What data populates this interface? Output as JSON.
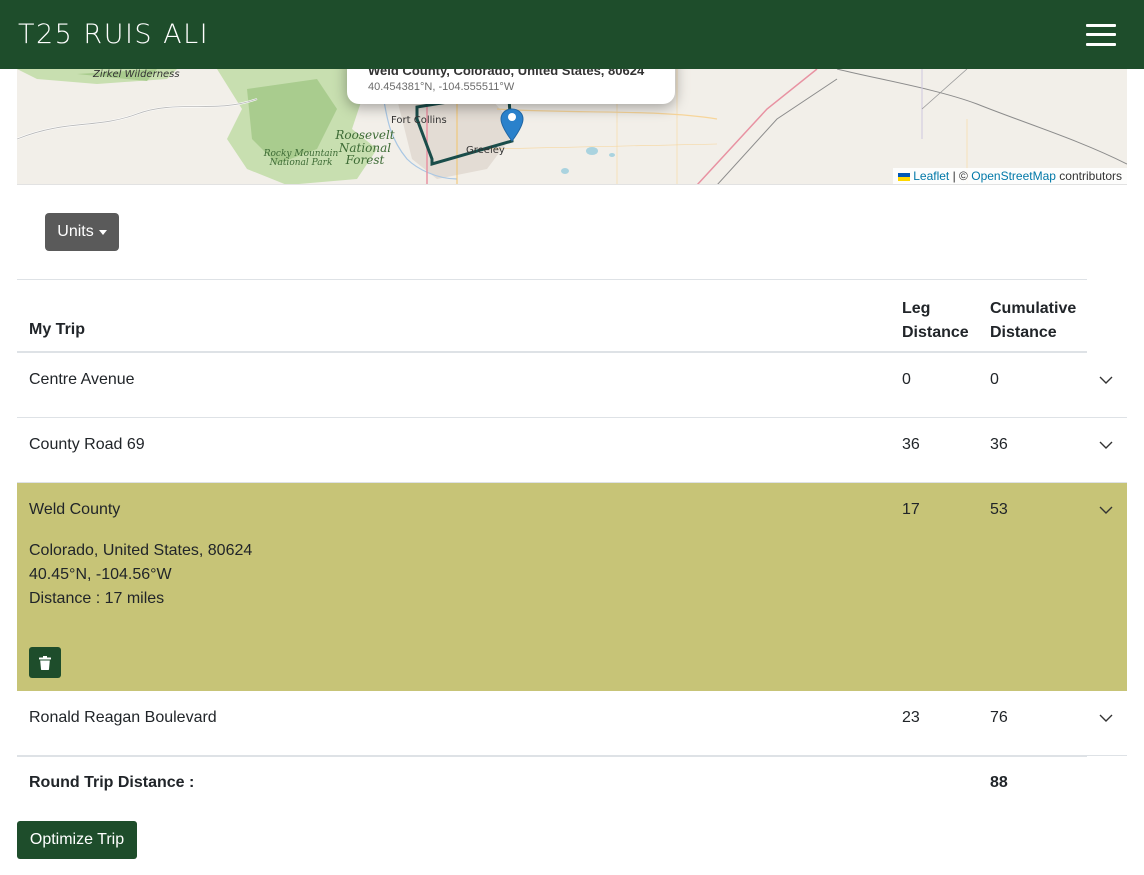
{
  "header": {
    "title": "T25 RUIS ALI",
    "menu_icon": "hamburger-menu-icon"
  },
  "map": {
    "popup_title": "Weld County, Colorado, United States, 80624",
    "popup_coords": "40.454381°N, -104.555511°W",
    "labels": {
      "zirkel": "Zirkel Wilderness",
      "fort_collins": "Fort Collins",
      "greeley": "Greeley",
      "roosevelt": "Roosevelt National Forest",
      "rocky": "Rocky Mountain National Park"
    },
    "attribution": {
      "leaflet": "Leaflet",
      "separator": "| ©",
      "osm": "OpenStreetMap",
      "suffix": "contributors"
    }
  },
  "units_button": {
    "label": "Units"
  },
  "table": {
    "headers": {
      "name": "My Trip",
      "leg": "Leg Distance",
      "cumulative": "Cumulative Distance"
    },
    "rows": [
      {
        "name": "Centre Avenue",
        "leg": "0",
        "cumulative": "0"
      },
      {
        "name": "County Road 69",
        "leg": "36",
        "cumulative": "36"
      },
      {
        "name": "Weld County",
        "leg": "17",
        "cumulative": "53",
        "details": {
          "address": "Colorado, United States, 80624",
          "coords": "40.45°N, -104.56°W",
          "distance": "Distance : 17 miles"
        }
      },
      {
        "name": "Ronald Reagan Boulevard",
        "leg": "23",
        "cumulative": "76"
      }
    ],
    "total": {
      "label": "Round Trip Distance :",
      "value": "88"
    }
  },
  "optimize_button": {
    "label": "Optimize Trip"
  },
  "colors": {
    "primary": "#1e4d2b",
    "highlight": "#c7c477",
    "units_button": "#5a5a5a",
    "route": "#1a4d4a",
    "marker": "#2a81cb"
  }
}
